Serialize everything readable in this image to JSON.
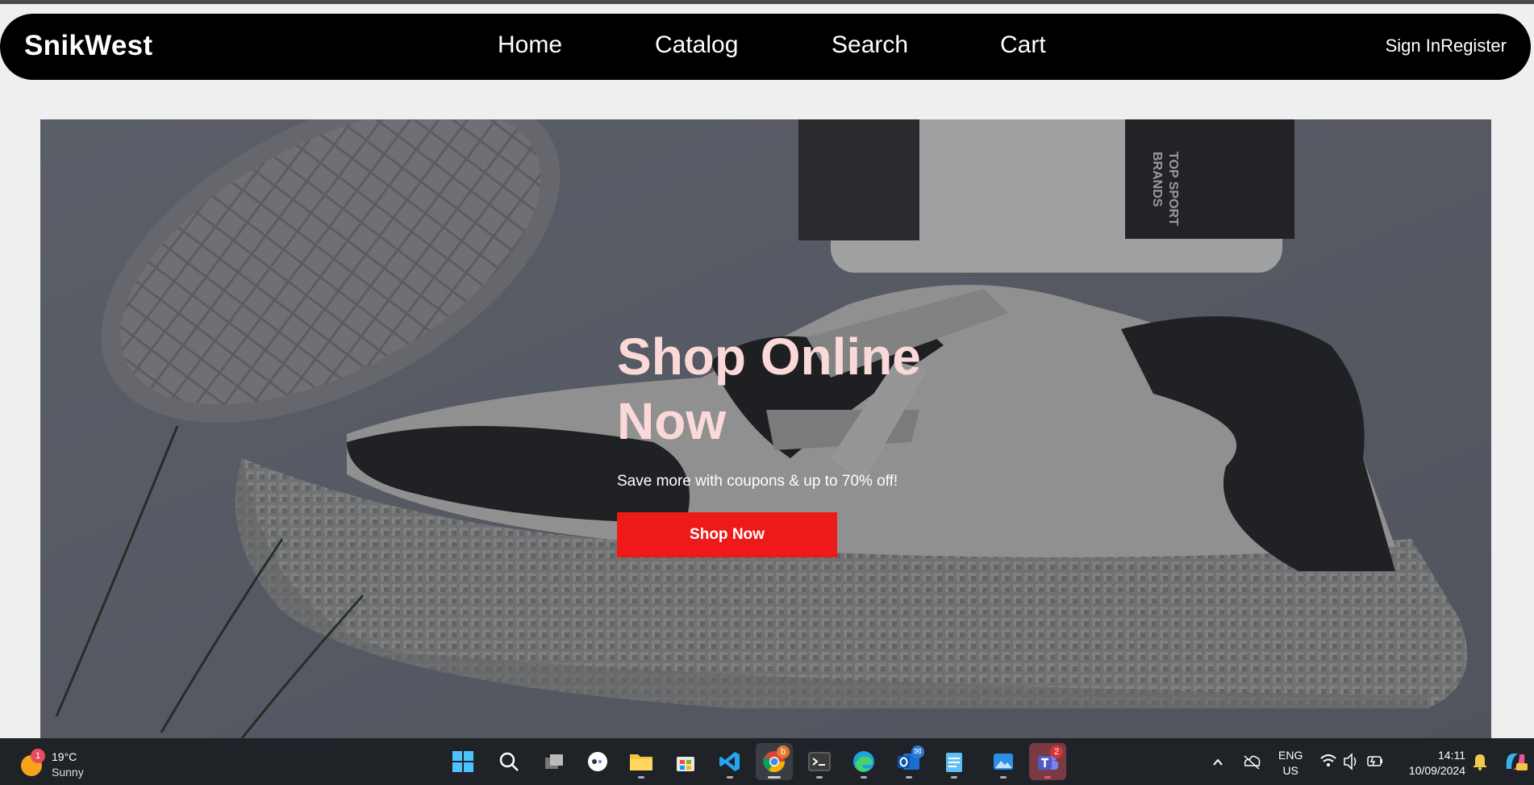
{
  "brand": "SnikWest",
  "nav": [
    {
      "label": "Home"
    },
    {
      "label": "Catalog"
    },
    {
      "label": "Search"
    },
    {
      "label": "Cart"
    }
  ],
  "auth": {
    "signin": "Sign In",
    "register": "Register"
  },
  "hero": {
    "title_line1": "Shop Online",
    "title_line2": "Now",
    "subtitle": "Save more with coupons & up to 70% off!",
    "cta": "Shop Now",
    "box_text_1": "TOP SPORT",
    "box_text_2": "BRANDS"
  },
  "taskbar": {
    "weather": {
      "badge": "1",
      "temp": "19°C",
      "condition": "Sunny"
    },
    "apps": [
      {
        "name": "start-icon"
      },
      {
        "name": "search-icon"
      },
      {
        "name": "task-view-icon"
      },
      {
        "name": "copilot-icon"
      },
      {
        "name": "file-explorer-icon"
      },
      {
        "name": "store-icon"
      },
      {
        "name": "vscode-icon"
      },
      {
        "name": "chrome-icon",
        "badge": "b"
      },
      {
        "name": "terminal-icon"
      },
      {
        "name": "edge-icon"
      },
      {
        "name": "outlook-icon"
      },
      {
        "name": "notepad-icon"
      },
      {
        "name": "photos-icon"
      },
      {
        "name": "teams-icon",
        "badge": "2"
      }
    ],
    "lang_line1": "ENG",
    "lang_line2": "US",
    "time": "14:11",
    "date": "10/09/2024"
  },
  "colors": {
    "navbar": "#000000",
    "accent_red": "#ee1a1a",
    "hero_title": "#fcd9d9",
    "taskbar": "#1f2327"
  }
}
